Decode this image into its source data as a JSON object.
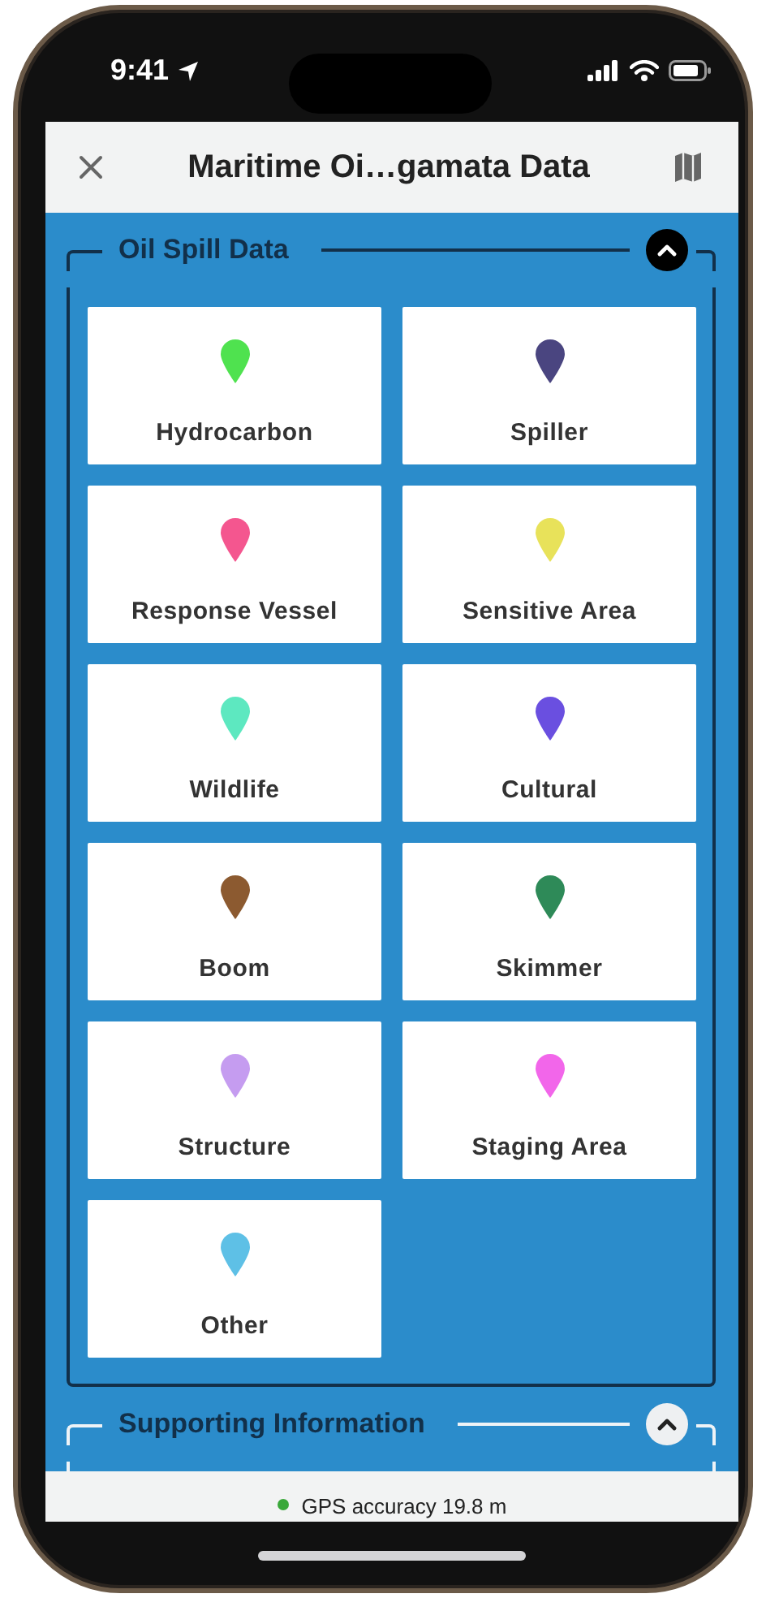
{
  "status_bar": {
    "time": "9:41"
  },
  "header": {
    "title": "Maritime Oi…gamata Data"
  },
  "sections": [
    {
      "title": "Oil Spill Data",
      "expanded": true,
      "focused": true,
      "items": [
        {
          "label": "Hydrocarbon",
          "color": "#4fe24f"
        },
        {
          "label": "Spiller",
          "color": "#4a4580"
        },
        {
          "label": "Response Vessel",
          "color": "#f4568f"
        },
        {
          "label": "Sensitive Area",
          "color": "#e8e25a"
        },
        {
          "label": "Wildlife",
          "color": "#5de8c0"
        },
        {
          "label": "Cultural",
          "color": "#6a4fe0"
        },
        {
          "label": "Boom",
          "color": "#8c5a30"
        },
        {
          "label": "Skimmer",
          "color": "#2e8a58"
        },
        {
          "label": "Structure",
          "color": "#c59cf0"
        },
        {
          "label": "Staging Area",
          "color": "#f266ea"
        },
        {
          "label": "Other",
          "color": "#5ec0e6"
        }
      ]
    },
    {
      "title": "Supporting Information",
      "expanded": true,
      "focused": false
    }
  ],
  "footer": {
    "gps": "GPS accuracy 19.8 m",
    "color": "#3aa83a"
  }
}
